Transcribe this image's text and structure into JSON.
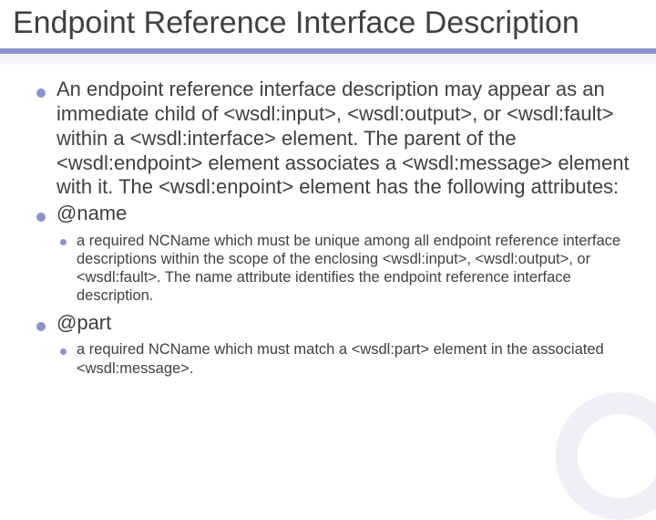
{
  "title": "Endpoint Reference Interface Description",
  "b1": "An endpoint reference interface description may appear as an immediate child of <wsdl:input>, <wsdl:output>, or <wsdl:fault> within a <wsdl:interface> element. The parent of the <wsdl:endpoint> element associates a <wsdl:message> element with it. The <wsdl:enpoint> element has the following attributes:",
  "b2": "@name",
  "b2s1": "a required NCName which must be unique among all endpoint reference interface descriptions within the scope of the enclosing <wsdl:input>, <wsdl:output>, or <wsdl:fault>. The name attribute identifies the endpoint reference interface description.",
  "b3": "@part",
  "b3s1": "a required NCName which must match a <wsdl:part> element in the associated <wsdl:message>."
}
